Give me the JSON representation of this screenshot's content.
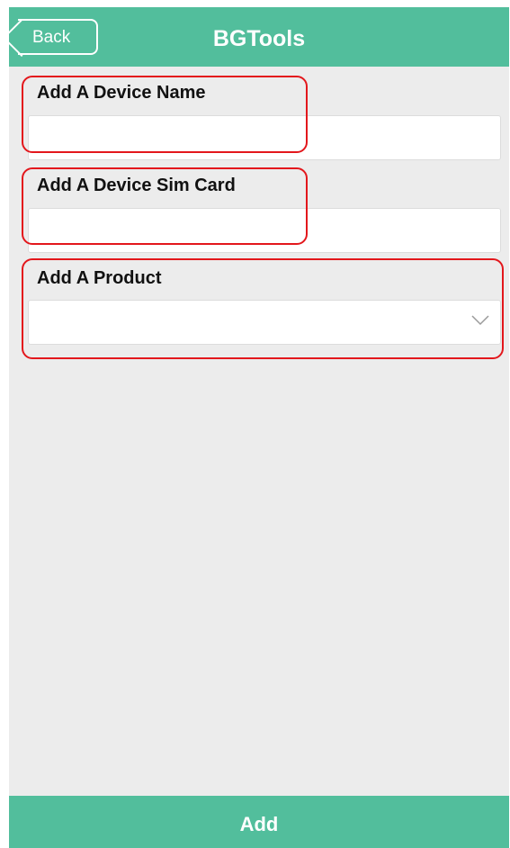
{
  "header": {
    "back_label": "Back",
    "title": "BGTools"
  },
  "form": {
    "device_name": {
      "label": "Add A Device Name",
      "value": "",
      "placeholder": ""
    },
    "sim_card": {
      "label": "Add A Device Sim Card",
      "value": "",
      "placeholder": ""
    },
    "product": {
      "label": "Add A Product",
      "selected": "",
      "icon": "chevron-down-icon"
    }
  },
  "footer": {
    "add_label": "Add"
  },
  "colors": {
    "accent": "#52be9c",
    "background": "#ececec",
    "highlight": "#e3171c"
  }
}
